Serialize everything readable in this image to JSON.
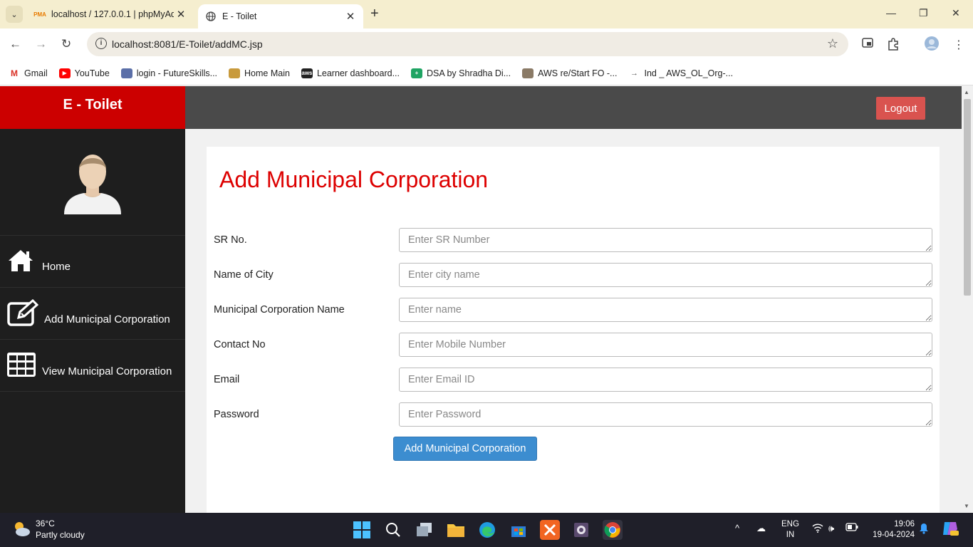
{
  "browser": {
    "tabs": [
      {
        "title": "localhost / 127.0.0.1 | phpMyAdmin",
        "favicon": "PMA"
      },
      {
        "title": "E - Toilet",
        "favicon": "globe-icon"
      }
    ],
    "url": "localhost:8081/E-Toilet/addMC.jsp",
    "bookmarks": [
      {
        "label": "Gmail",
        "icon": "gmail-icon"
      },
      {
        "label": "YouTube",
        "icon": "youtube-icon"
      },
      {
        "label": "login - FutureSkills...",
        "icon": "futureskills-icon"
      },
      {
        "label": "Home Main",
        "icon": "home-main-icon"
      },
      {
        "label": "Learner dashboard...",
        "icon": "aws-icon"
      },
      {
        "label": "DSA by Shradha Di...",
        "icon": "sheets-icon"
      },
      {
        "label": "AWS re/Start FO -...",
        "icon": "aws-restart-icon"
      },
      {
        "label": "Ind _ AWS_OL_Org-...",
        "icon": "arrow-icon"
      }
    ]
  },
  "app": {
    "brand": "E - Toilet",
    "logout_label": "Logout",
    "sidebar": {
      "items": [
        {
          "label": "Home",
          "icon": "home-icon"
        },
        {
          "label": "Add Municipal Corporation",
          "icon": "edit-icon"
        },
        {
          "label": "View Municipal Corporation",
          "icon": "table-icon"
        }
      ]
    },
    "page_title": "Add Municipal Corporation",
    "form": {
      "fields": [
        {
          "label": "SR No.",
          "placeholder": "Enter SR Number"
        },
        {
          "label": "Name of City",
          "placeholder": "Enter city name"
        },
        {
          "label": "Municipal Corporation Name",
          "placeholder": "Enter name"
        },
        {
          "label": "Contact No",
          "placeholder": "Enter Mobile Number"
        },
        {
          "label": "Email",
          "placeholder": "Enter Email ID"
        },
        {
          "label": "Password",
          "placeholder": "Enter Password"
        }
      ],
      "submit_label": "Add Municipal Corporation"
    },
    "colors": {
      "brand": "#cc0000",
      "title": "#dd0000",
      "logout": "#d9534f",
      "submit": "#3c8dd0",
      "sidebar": "#1e1e1e",
      "topbar": "#4a4a4a"
    }
  },
  "taskbar": {
    "weather_temp": "36°C",
    "weather_desc": "Partly cloudy",
    "lang_line1": "ENG",
    "lang_line2": "IN",
    "time": "19:06",
    "date": "19-04-2024"
  }
}
